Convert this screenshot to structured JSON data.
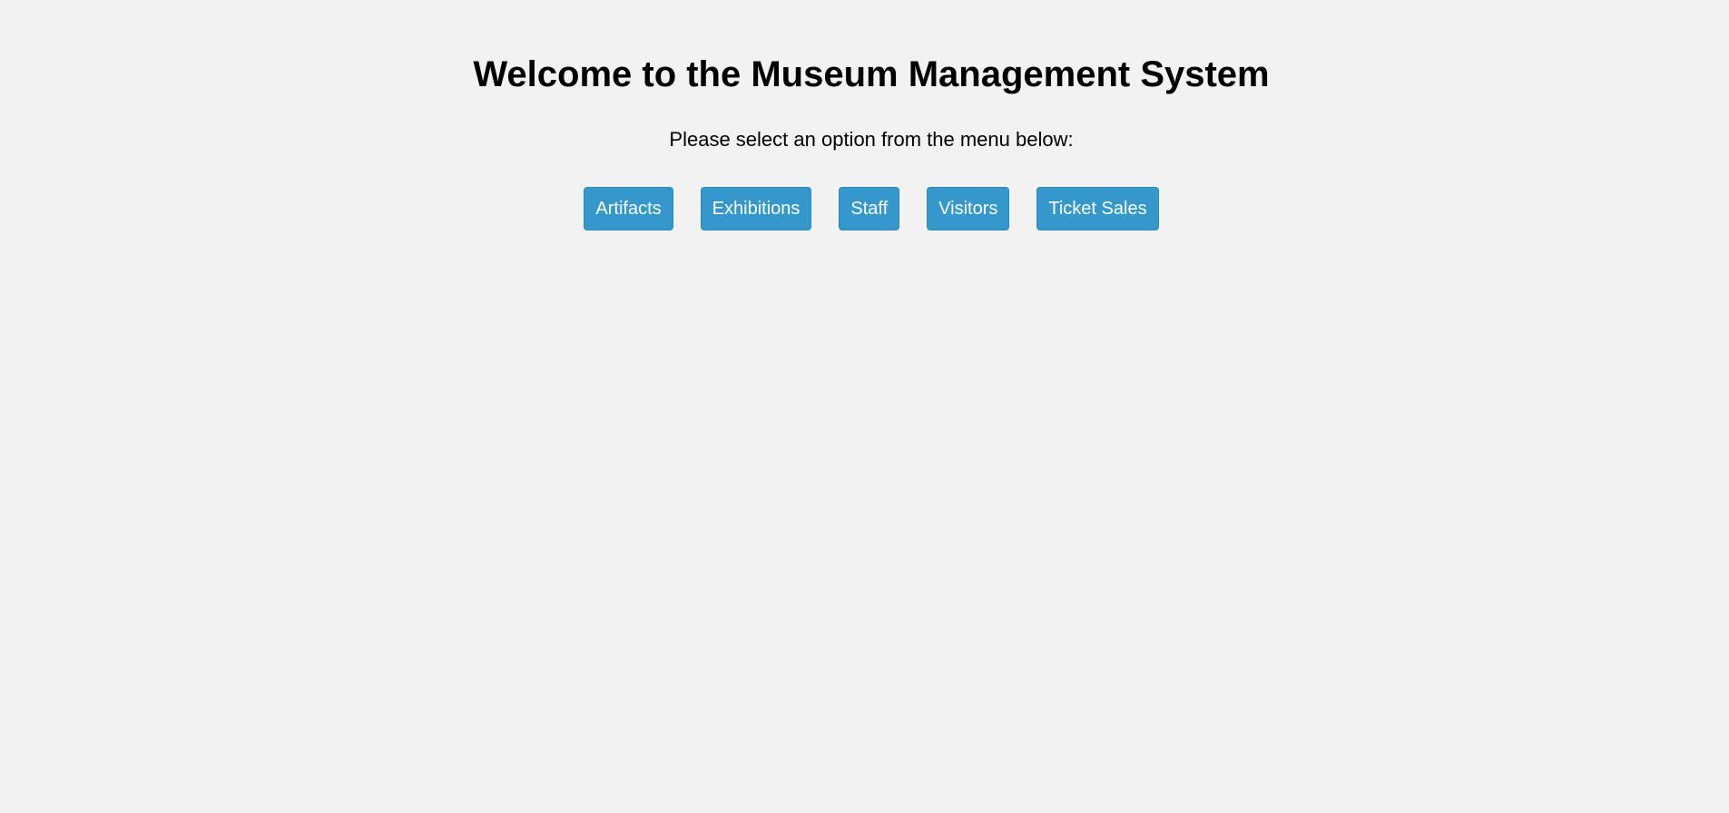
{
  "header": {
    "title": "Welcome to the Museum Management System",
    "subtitle": "Please select an option from the menu below:"
  },
  "menu": {
    "items": [
      {
        "label": "Artifacts"
      },
      {
        "label": "Exhibitions"
      },
      {
        "label": "Staff"
      },
      {
        "label": "Visitors"
      },
      {
        "label": "Ticket Sales"
      }
    ]
  },
  "colors": {
    "background": "#f2f2f2",
    "button": "#3498cc",
    "button_text": "#ffffff",
    "text": "#000000"
  }
}
